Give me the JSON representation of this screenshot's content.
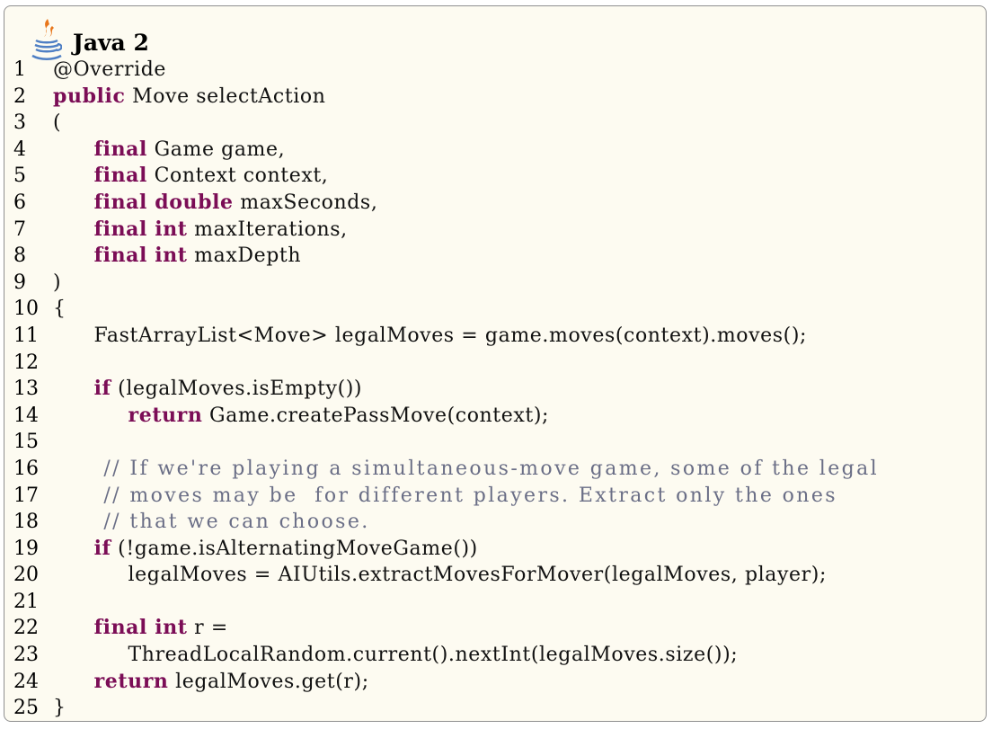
{
  "header": {
    "icon": "java-coffee-cup-icon",
    "title": "Java 2"
  },
  "colors": {
    "background": "#fdfbf1",
    "border": "#8f8f8f",
    "keyword": "#7b0d56",
    "comment": "#6a6e86",
    "java_orange": "#e8761b",
    "java_blue": "#4f7fc4"
  },
  "code_lines": [
    {
      "num": "1",
      "tokens": [
        {
          "t": "@Override",
          "k": "p"
        }
      ]
    },
    {
      "num": "2",
      "tokens": [
        {
          "t": "public",
          "k": "kw"
        },
        {
          "t": " Move selectAction",
          "k": "p"
        }
      ]
    },
    {
      "num": "3",
      "tokens": [
        {
          "t": "(",
          "k": "p"
        }
      ]
    },
    {
      "num": "4",
      "tokens": [
        {
          "t": "      ",
          "k": "p"
        },
        {
          "t": "final",
          "k": "kw"
        },
        {
          "t": " Game game,",
          "k": "p"
        }
      ]
    },
    {
      "num": "5",
      "tokens": [
        {
          "t": "      ",
          "k": "p"
        },
        {
          "t": "final",
          "k": "kw"
        },
        {
          "t": " Context context,",
          "k": "p"
        }
      ]
    },
    {
      "num": "6",
      "tokens": [
        {
          "t": "      ",
          "k": "p"
        },
        {
          "t": "final double",
          "k": "kw"
        },
        {
          "t": " maxSeconds,",
          "k": "p"
        }
      ]
    },
    {
      "num": "7",
      "tokens": [
        {
          "t": "      ",
          "k": "p"
        },
        {
          "t": "final int",
          "k": "kw"
        },
        {
          "t": " maxIterations,",
          "k": "p"
        }
      ]
    },
    {
      "num": "8",
      "tokens": [
        {
          "t": "      ",
          "k": "p"
        },
        {
          "t": "final int",
          "k": "kw"
        },
        {
          "t": " maxDepth",
          "k": "p"
        }
      ]
    },
    {
      "num": "9",
      "tokens": [
        {
          "t": ")",
          "k": "p"
        }
      ]
    },
    {
      "num": "10",
      "tokens": [
        {
          "t": "{",
          "k": "p"
        }
      ]
    },
    {
      "num": "11",
      "tokens": [
        {
          "t": "      FastArrayList<Move> legalMoves = game.moves(context).moves();",
          "k": "p"
        }
      ]
    },
    {
      "num": "12",
      "tokens": []
    },
    {
      "num": "13",
      "tokens": [
        {
          "t": "      ",
          "k": "p"
        },
        {
          "t": "if",
          "k": "kw"
        },
        {
          "t": " (legalMoves.isEmpty())",
          "k": "p"
        }
      ]
    },
    {
      "num": "14",
      "tokens": [
        {
          "t": "           ",
          "k": "p"
        },
        {
          "t": "return",
          "k": "kw"
        },
        {
          "t": " Game.createPassMove(context);",
          "k": "p"
        }
      ]
    },
    {
      "num": "15",
      "tokens": []
    },
    {
      "num": "16",
      "tokens": [
        {
          "t": "      // If we're playing a simultaneous-move game, some of the legal",
          "k": "cm"
        }
      ]
    },
    {
      "num": "17",
      "tokens": [
        {
          "t": "      // moves may be  for different players. Extract only the ones",
          "k": "cm"
        }
      ]
    },
    {
      "num": "18",
      "tokens": [
        {
          "t": "      // that we can choose.",
          "k": "cm"
        }
      ]
    },
    {
      "num": "19",
      "tokens": [
        {
          "t": "      ",
          "k": "p"
        },
        {
          "t": "if",
          "k": "kw"
        },
        {
          "t": " (!game.isAlternatingMoveGame())",
          "k": "p"
        }
      ]
    },
    {
      "num": "20",
      "tokens": [
        {
          "t": "           legalMoves = AIUtils.extractMovesForMover(legalMoves, player);",
          "k": "p"
        }
      ]
    },
    {
      "num": "21",
      "tokens": []
    },
    {
      "num": "22",
      "tokens": [
        {
          "t": "      ",
          "k": "p"
        },
        {
          "t": "final int",
          "k": "kw"
        },
        {
          "t": " r =",
          "k": "p"
        }
      ]
    },
    {
      "num": "23",
      "tokens": [
        {
          "t": "           ThreadLocalRandom.current().nextInt(legalMoves.size());",
          "k": "p"
        }
      ]
    },
    {
      "num": "24",
      "tokens": [
        {
          "t": "      ",
          "k": "p"
        },
        {
          "t": "return",
          "k": "kw"
        },
        {
          "t": " legalMoves.get(r);",
          "k": "p"
        }
      ]
    },
    {
      "num": "25",
      "tokens": [
        {
          "t": "}",
          "k": "p"
        }
      ]
    }
  ]
}
